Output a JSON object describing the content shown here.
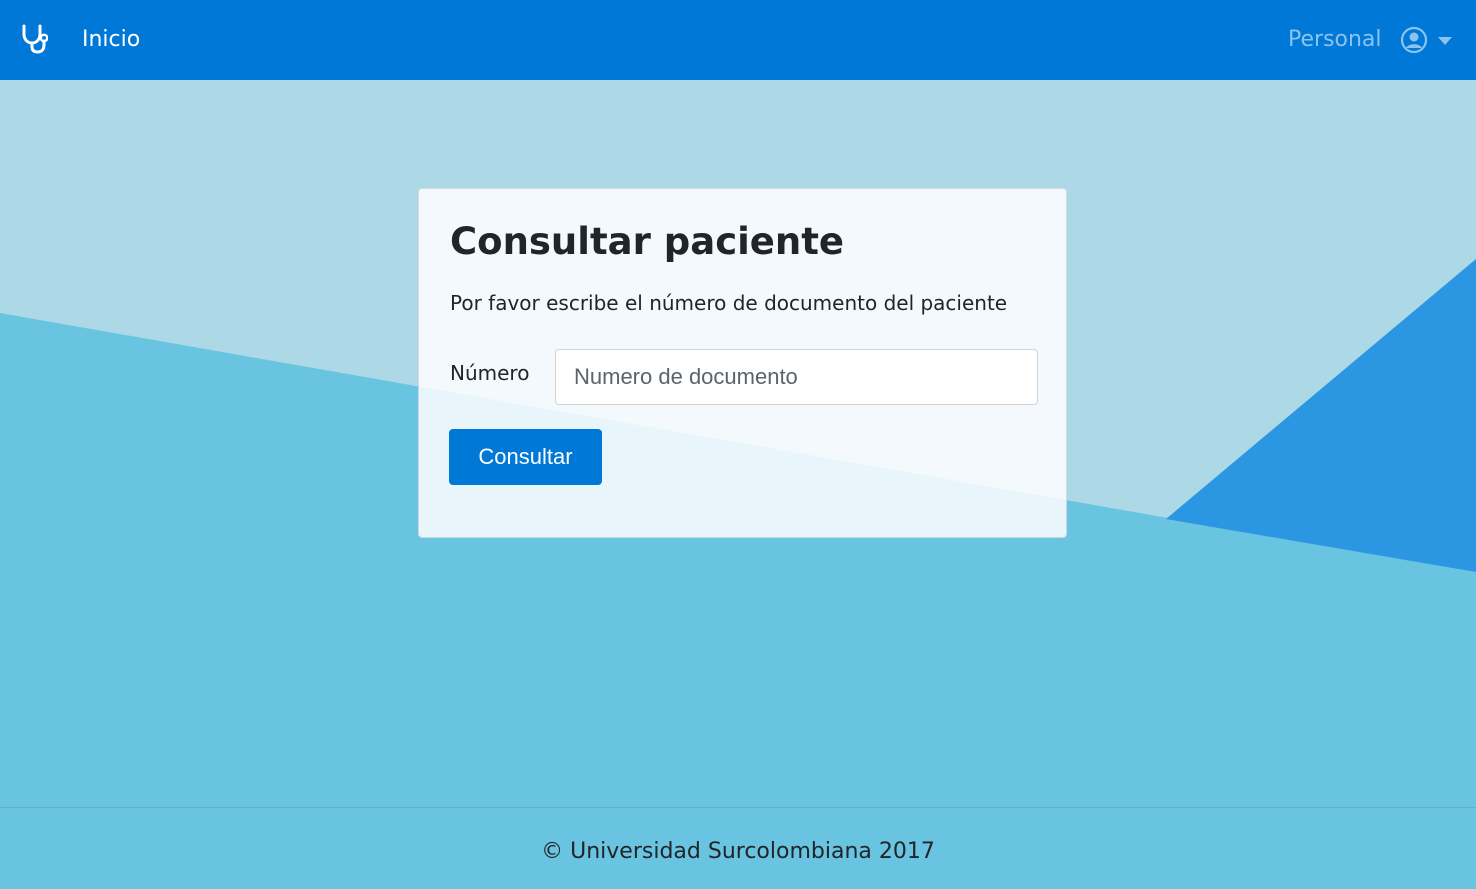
{
  "navbar": {
    "brand_icon": "stethoscope-icon",
    "home_label": "Inicio",
    "personal_label": "Personal",
    "user_icon": "user-circle-icon",
    "caret_icon": "caret-down-icon",
    "background_color": "#0078d7"
  },
  "card": {
    "title": "Consultar paciente",
    "subtitle": "Por favor escribe el número de documento del paciente",
    "field_label": "Número",
    "input_placeholder": "Numero de documento",
    "input_value": "",
    "submit_label": "Consultar"
  },
  "footer": {
    "text": "© Universidad Surcolombiana 2017"
  },
  "colors": {
    "accent": "#0078d7",
    "background_light": "#add8e6",
    "background_mid": "#69c4e2",
    "background_dark": "#2b96e1"
  }
}
